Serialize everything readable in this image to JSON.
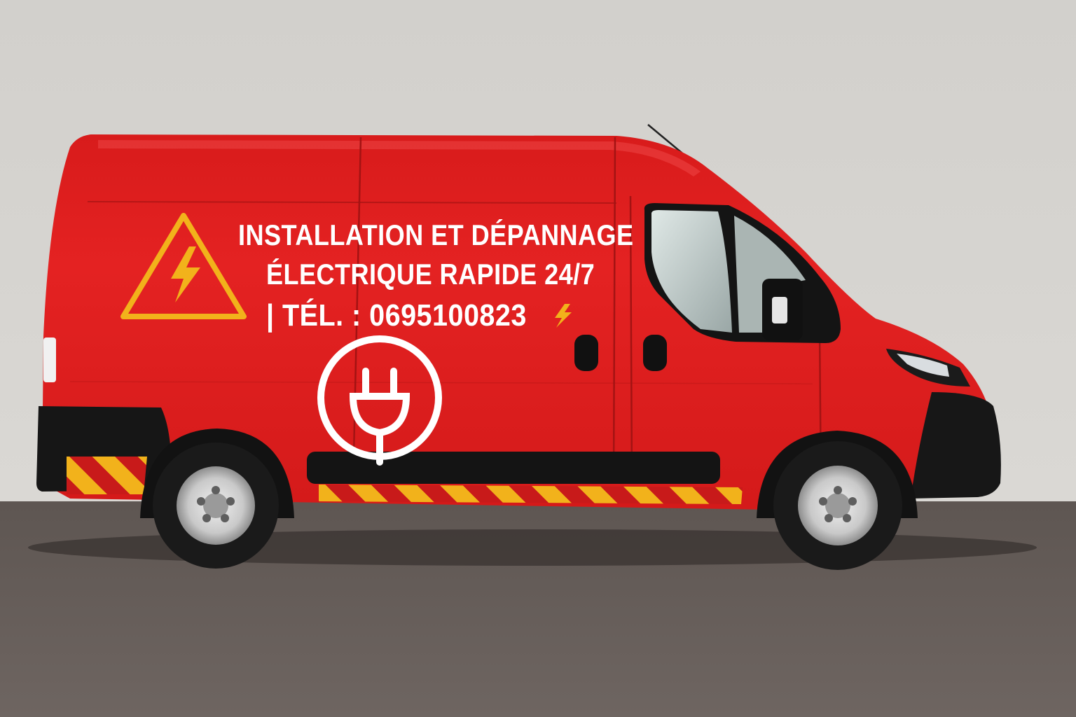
{
  "scene": {
    "subject": "van",
    "colors": {
      "wall": "#d6d4d0",
      "floor": "#6b625e",
      "van_body": "#e41f1f",
      "trim": "#161616",
      "warning_yellow": "#f2b21b",
      "text": "#ffffff"
    }
  },
  "livery": {
    "line1": "INSTALLATION ET DÉPANNAGE",
    "line2": "ÉLECTRIQUE RAPIDE 24/7",
    "line3": "| TÉL. : 0695100823",
    "icons": [
      "warning-triangle-icon",
      "lightning-bolt-icon",
      "plug-icon"
    ]
  }
}
